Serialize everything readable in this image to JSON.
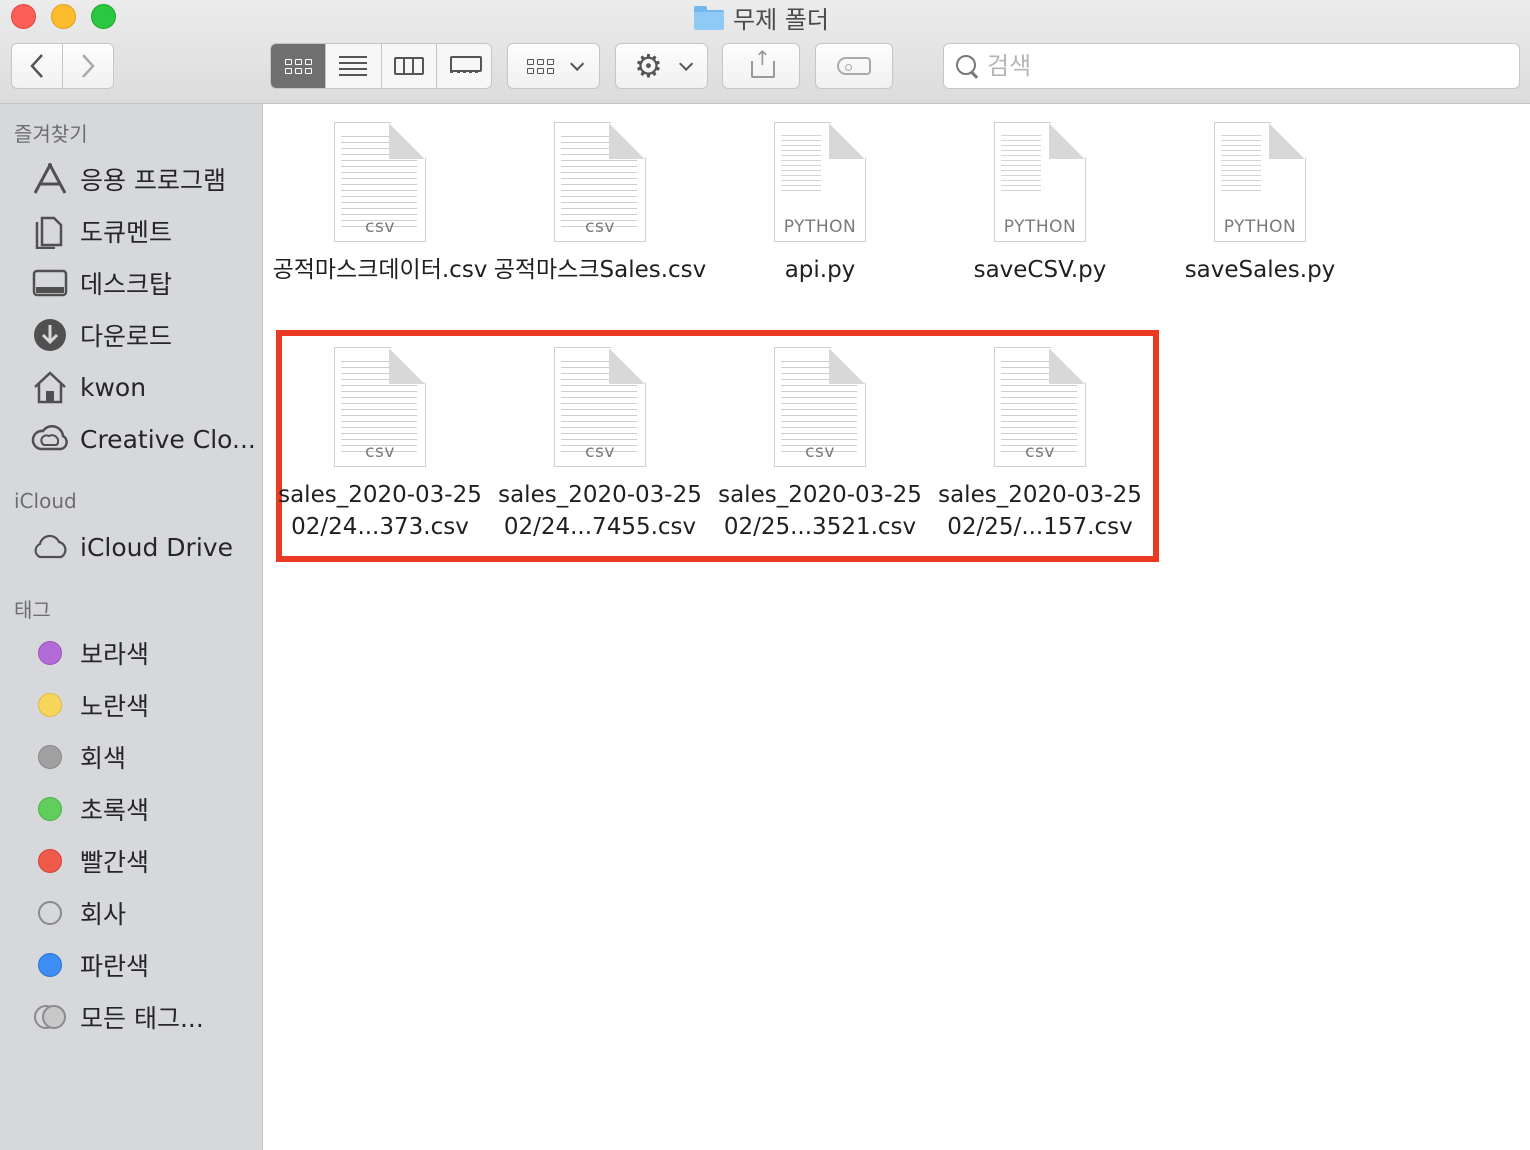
{
  "window": {
    "title": "무제 폴더"
  },
  "toolbar": {
    "search_placeholder": "검색"
  },
  "sidebar": {
    "favorites_header": "즐겨찾기",
    "favorites": [
      {
        "label": "응용 프로그램",
        "icon": "applications-icon"
      },
      {
        "label": "도큐멘트",
        "icon": "documents-icon"
      },
      {
        "label": "데스크탑",
        "icon": "desktop-icon"
      },
      {
        "label": "다운로드",
        "icon": "downloads-icon"
      },
      {
        "label": "kwon",
        "icon": "home-icon"
      },
      {
        "label": "Creative Clo...",
        "icon": "creative-cloud-icon"
      }
    ],
    "icloud_header": "iCloud",
    "icloud": [
      {
        "label": "iCloud Drive",
        "icon": "cloud-icon"
      }
    ],
    "tags_header": "태그",
    "tags": [
      {
        "label": "보라색",
        "color": "#b36bd8"
      },
      {
        "label": "노란색",
        "color": "#f8d55c"
      },
      {
        "label": "회색",
        "color": "#a0a0a0"
      },
      {
        "label": "초록색",
        "color": "#5fce5a"
      },
      {
        "label": "빨간색",
        "color": "#f05a4b"
      },
      {
        "label": "회사",
        "color": "#d9d9d9"
      },
      {
        "label": "파란색",
        "color": "#3d8df5"
      },
      {
        "label": "모든 태그...",
        "color": "#c8c8c8"
      }
    ]
  },
  "files": [
    {
      "name": "공적마스크데이터.csv",
      "kind": "CSV"
    },
    {
      "name": "공적마스크Sales.csv",
      "kind": "CSV"
    },
    {
      "name": "api.py",
      "kind": "PYTHON"
    },
    {
      "name": "saveCSV.py",
      "kind": "PYTHON"
    },
    {
      "name": "saveSales.py",
      "kind": "PYTHON"
    },
    {
      "name": "sales_2020-03-25 02/24...373.csv",
      "kind": "CSV"
    },
    {
      "name": "sales_2020-03-25 02/24...7455.csv",
      "kind": "CSV"
    },
    {
      "name": "sales_2020-03-25 02/25...3521.csv",
      "kind": "CSV"
    },
    {
      "name": "sales_2020-03-25 02/25/...157.csv",
      "kind": "CSV"
    }
  ],
  "highlight_color": "#ea3a24"
}
